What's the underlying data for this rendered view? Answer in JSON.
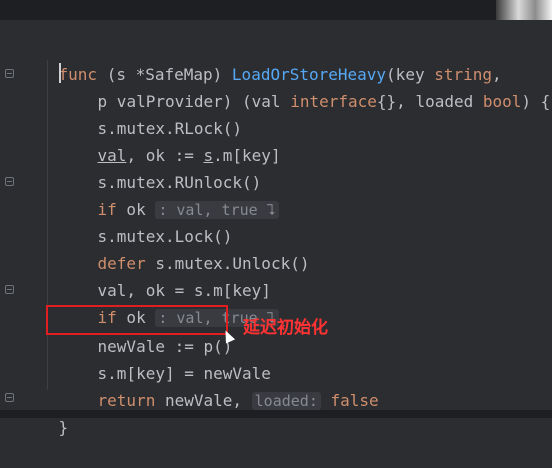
{
  "editor": {
    "lines": [
      [
        "func",
        " (s ",
        "*SafeMap",
        ") ",
        "LoadOrStoreHeavy",
        "(key ",
        "string",
        ","
      ],
      [
        "p",
        " valProvider) (val ",
        "interface",
        "{}, loaded ",
        "bool",
        ") {"
      ],
      [
        "s.mutex.",
        "RLock",
        "()"
      ],
      [
        "val",
        ", ok := ",
        "s",
        ".m[key]"
      ],
      [
        "s.mutex.",
        "RUnlock",
        "()"
      ],
      [
        "if",
        " ok ",
        ": val, true ⮧"
      ],
      [
        "s.mutex.",
        "Lock",
        "()"
      ],
      [
        "defer",
        " s.mutex.",
        "Unlock",
        "()"
      ],
      [
        "val, ok = s.m[key]"
      ],
      [
        "if",
        " ok ",
        ": val, true ⮧"
      ],
      [
        "newVale := p()"
      ],
      [
        "s.m[key] = newVale"
      ],
      [
        "return",
        " newVale, ",
        "loaded:",
        " false"
      ],
      [
        "}"
      ]
    ]
  },
  "annotation": {
    "text": "延迟初始化"
  },
  "colors": {
    "background": "#2b2d30",
    "keyword": "#cf8e6d",
    "function": "#56a8f5",
    "text": "#bcbec4",
    "hint": "#868a91",
    "annotation_red": "#ff3333",
    "box_red": "#e02020"
  },
  "icons": [
    "fold-marker-icon",
    "mouse-cursor-icon"
  ]
}
